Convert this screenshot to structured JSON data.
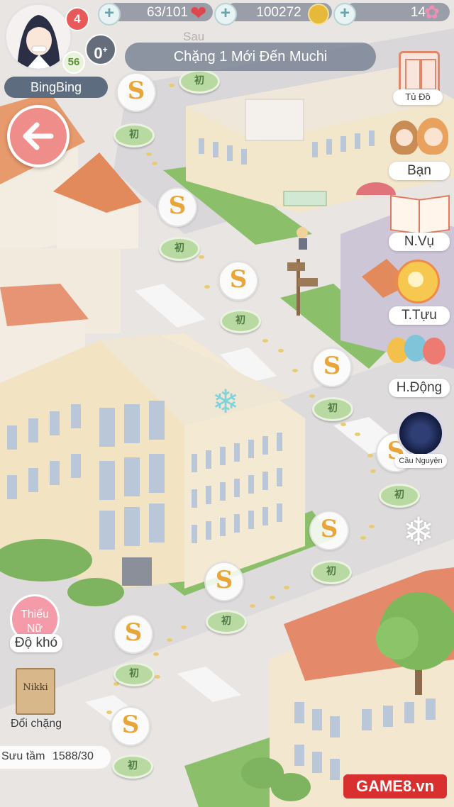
{
  "header": {
    "hearts_badge": "4",
    "level_badge": "56",
    "energy": "63/101",
    "coins": "100272",
    "diamonds": "14",
    "zero_label": "0",
    "username": "BingBing",
    "stage_title": "Chặng 1 Mới Đến Muchi",
    "faded_text": "Sau"
  },
  "side_menu": {
    "wardrobe": "Tủ Đồ",
    "friends": "Bạn",
    "tasks": "N.Vụ",
    "collect": "T.Tựu",
    "activity": "H.Động",
    "wish": "Cầu Nguyện"
  },
  "left_panel": {
    "difficulty_badge": "Thiếu Nữ",
    "difficulty_label": "Độ khó",
    "book_title": "Nikki",
    "change_stage": "Đổi chặng",
    "collection_label": "Sưu tầm",
    "collection_value": "1588/30"
  },
  "map_nodes": {
    "bubble_letter": "S",
    "pad_label": "初"
  },
  "watermark": "GAME8.vn",
  "colors": {
    "back_button": "#ee8d8a",
    "heart": "#e0474c",
    "coin": "#e6b93a",
    "diamond": "#f08fb6",
    "pad": "#b9d9a2"
  }
}
